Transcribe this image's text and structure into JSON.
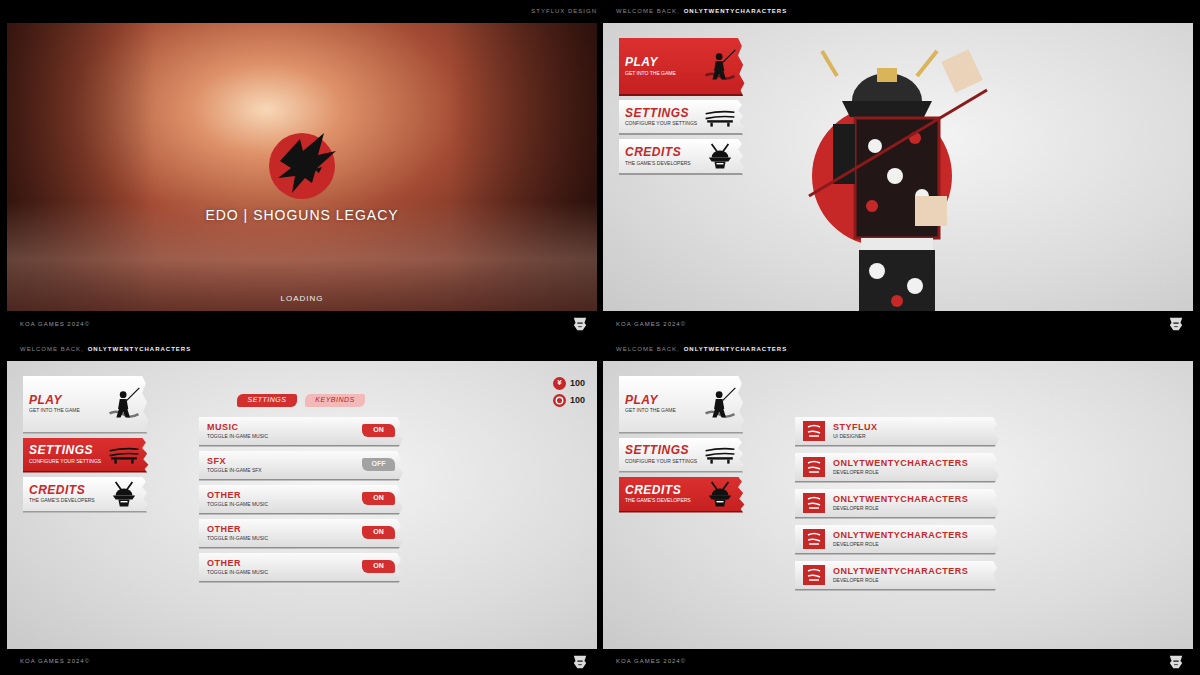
{
  "frames": [
    {
      "kind": "loading",
      "header": {
        "label": "STYFLUX DESIGN"
      },
      "title": "EDO | SHOGUNS LEGACY",
      "status": "LOADING",
      "footer": "KOA GAMES 2024©"
    },
    {
      "kind": "menu",
      "header": {
        "label": "WELCOME BACK,",
        "user": "ONLYTWENTYCHARACTERS"
      },
      "menu": [
        {
          "label": "PLAY",
          "caption": "GET INTO THE GAME",
          "selected": true
        },
        {
          "label": "SETTINGS",
          "caption": "CONFIGURE YOUR SETTINGS",
          "selected": false
        },
        {
          "label": "CREDITS",
          "caption": "THE GAME'S DEVELOPERS",
          "selected": false
        }
      ],
      "footer": "KOA GAMES 2024©"
    },
    {
      "kind": "settings",
      "header": {
        "label": "WELCOME BACK,",
        "user": "ONLYTWENTYCHARACTERS"
      },
      "menu": [
        {
          "label": "PLAY",
          "caption": "GET INTO THE GAME",
          "selected": false
        },
        {
          "label": "SETTINGS",
          "caption": "CONFIGURE YOUR SETTINGS",
          "selected": true
        },
        {
          "label": "CREDITS",
          "caption": "THE GAME'S DEVELOPERS",
          "selected": false
        }
      ],
      "tabs": [
        {
          "label": "SETTINGS",
          "selected": true
        },
        {
          "label": "KEYBINDS",
          "selected": false
        }
      ],
      "toggles": [
        {
          "label": "MUSIC",
          "caption": "TOGGLE IN-GAME MUSIC",
          "on": true,
          "state": "ON"
        },
        {
          "label": "SFX",
          "caption": "TOGGLE IN-GAME SFX",
          "on": false,
          "state": "OFF"
        },
        {
          "label": "OTHER",
          "caption": "TOGGLE IN-GAME MUSIC",
          "on": true,
          "state": "ON"
        },
        {
          "label": "OTHER",
          "caption": "TOGGLE IN-GAME MUSIC",
          "on": true,
          "state": "ON"
        },
        {
          "label": "OTHER",
          "caption": "TOGGLE IN-GAME MUSIC",
          "on": true,
          "state": "ON"
        }
      ],
      "currency": [
        {
          "symbol": "¥",
          "amount": "100"
        },
        {
          "amount": "100"
        }
      ],
      "footer": "KOA GAMES 2024©"
    },
    {
      "kind": "credits",
      "header": {
        "label": "WELCOME BACK,",
        "user": "ONLYTWENTYCHARACTERS"
      },
      "menu": [
        {
          "label": "PLAY",
          "caption": "GET INTO THE GAME",
          "selected": false
        },
        {
          "label": "SETTINGS",
          "caption": "CONFIGURE YOUR SETTINGS",
          "selected": false
        },
        {
          "label": "CREDITS",
          "caption": "THE GAME'S DEVELOPERS",
          "selected": true
        }
      ],
      "credits": [
        {
          "name": "STYFLUX",
          "role": "UI DESIGNER"
        },
        {
          "name": "ONLYTWENTYCHARACTERS",
          "role": "DEVELOPER ROLE"
        },
        {
          "name": "ONLYTWENTYCHARACTERS",
          "role": "DEVELOPER ROLE"
        },
        {
          "name": "ONLYTWENTYCHARACTERS",
          "role": "DEVELOPER ROLE"
        },
        {
          "name": "ONLYTWENTYCHARACTERS",
          "role": "DEVELOPER ROLE"
        }
      ],
      "footer": "KOA GAMES 2024©"
    }
  ]
}
